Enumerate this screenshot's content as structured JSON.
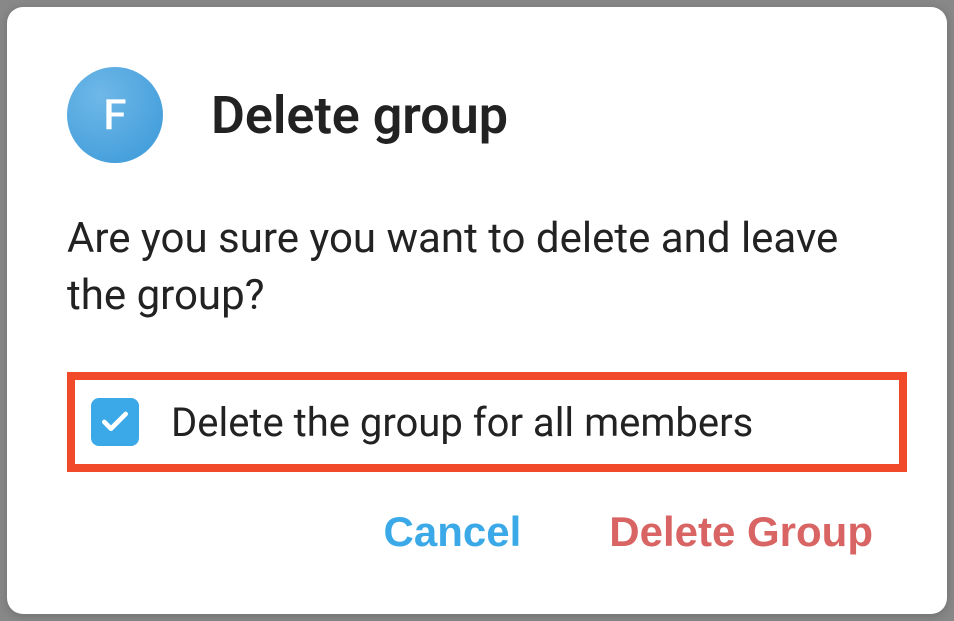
{
  "dialog": {
    "avatar_letter": "F",
    "title": "Delete group",
    "message": "Are you sure you want to delete and leave the group?",
    "checkbox_label": "Delete the group for all members",
    "checkbox_checked": true,
    "actions": {
      "cancel": "Cancel",
      "delete": "Delete Group"
    }
  },
  "colors": {
    "accent": "#3ba9e8",
    "danger": "#d96464",
    "highlight_border": "#f04a2a"
  }
}
